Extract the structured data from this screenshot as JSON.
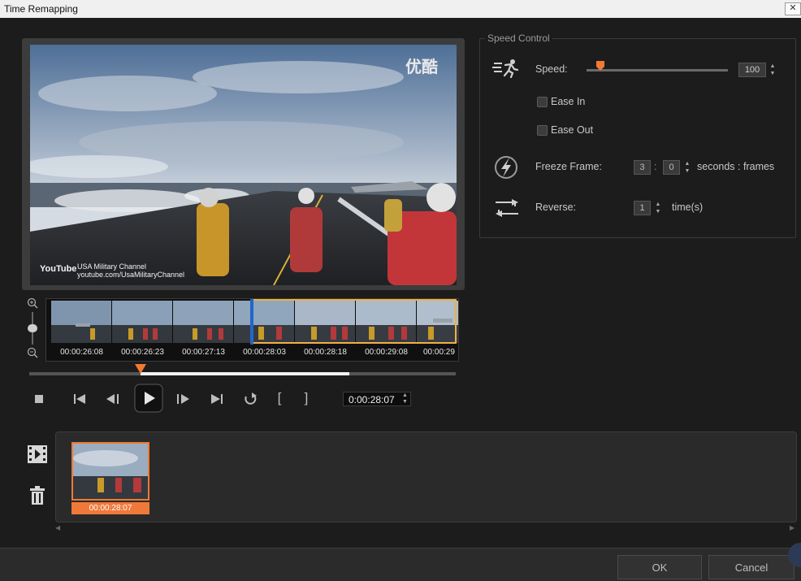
{
  "window": {
    "title": "Time Remapping",
    "close_label": "✕"
  },
  "preview": {
    "watermark_logo": "优酷",
    "channel_logo": "YouTube",
    "channel_name": "USA Military Channel",
    "channel_url": "youtube.com/UsaMilitaryChannel"
  },
  "thumbnails": {
    "timecodes": [
      "00:00:26:08",
      "00:00:26:23",
      "00:00:27:13",
      "00:00:28:03",
      "00:00:28:18",
      "00:00:29:08",
      "00:00:29"
    ],
    "zoom_in_icon": "zoom-in-icon",
    "zoom_out_icon": "zoom-out-icon"
  },
  "playback": {
    "progress": 0.26,
    "selection_end": 0.75,
    "timecode": "0:00:28:07",
    "icons": [
      "stop-icon",
      "skip-start-icon",
      "frame-back-icon",
      "play-icon",
      "frame-forward-icon",
      "skip-end-icon",
      "repeat-icon"
    ],
    "mark_in": "[",
    "mark_out": "]"
  },
  "speed_control": {
    "legend": "Speed Control",
    "speed_label": "Speed:",
    "speed_value": "100",
    "speed_fraction": 0.1,
    "ease_in_label": "Ease In",
    "ease_out_label": "Ease Out",
    "freeze_label": "Freeze Frame:",
    "freeze_seconds": "3",
    "freeze_sep": ":",
    "freeze_frames": "0",
    "freeze_units": "seconds : frames",
    "reverse_label": "Reverse:",
    "reverse_value": "1",
    "reverse_units": "time(s)"
  },
  "timeline": {
    "clip_timecode": "00:00:28:07"
  },
  "buttons": {
    "ok": "OK",
    "cancel": "Cancel"
  },
  "colors": {
    "accent": "#f07a32",
    "selection": "#f0b040",
    "playhead": "#2266cc"
  }
}
